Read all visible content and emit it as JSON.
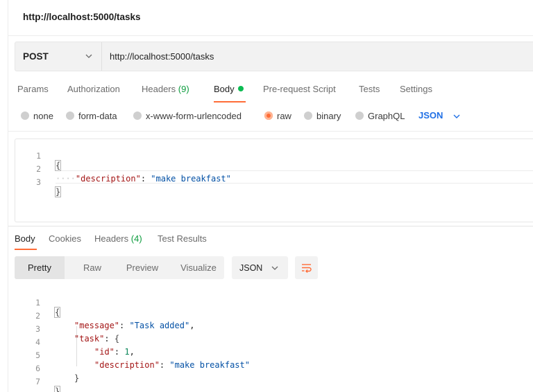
{
  "window": {
    "title": "http://localhost:5000/tasks"
  },
  "request": {
    "method": "POST",
    "url": "http://localhost:5000/tasks"
  },
  "request_tabs": {
    "params": "Params",
    "authorization": "Authorization",
    "headers": "Headers",
    "headers_count": "(9)",
    "body": "Body",
    "pre_request": "Pre-request Script",
    "tests": "Tests",
    "settings": "Settings"
  },
  "body_modes": {
    "none": "none",
    "form_data": "form-data",
    "urlencoded": "x-www-form-urlencoded",
    "raw": "raw",
    "binary": "binary",
    "graphql": "GraphQL",
    "format": "JSON"
  },
  "request_body": {
    "lines": [
      "1",
      "2",
      "3"
    ],
    "open_brace": "{",
    "indent": "····",
    "key": "\"description\"",
    "colon": ": ",
    "value": "\"make breakfast\"",
    "close_brace": "}"
  },
  "response_tabs": {
    "body": "Body",
    "cookies": "Cookies",
    "headers": "Headers",
    "headers_count": "(4)",
    "test_results": "Test Results"
  },
  "view_modes": {
    "pretty": "Pretty",
    "raw": "Raw",
    "preview": "Preview",
    "visualize": "Visualize",
    "format": "JSON"
  },
  "response_body": {
    "lines": [
      "1",
      "2",
      "3",
      "4",
      "5",
      "6",
      "7"
    ],
    "open_brace": "{",
    "message_key": "\"message\"",
    "message_value": "\"Task added\"",
    "task_key": "\"task\"",
    "task_open": "{",
    "id_key": "\"id\"",
    "id_value": "1",
    "desc_key": "\"description\"",
    "desc_value": "\"make breakfast\"",
    "task_close": "}",
    "close_brace": "}"
  },
  "icons": {
    "chevron": "chevron-down-icon",
    "wrap": "word-wrap-icon",
    "accent": "#ff6c37",
    "link_blue": "#1f6fe5"
  }
}
